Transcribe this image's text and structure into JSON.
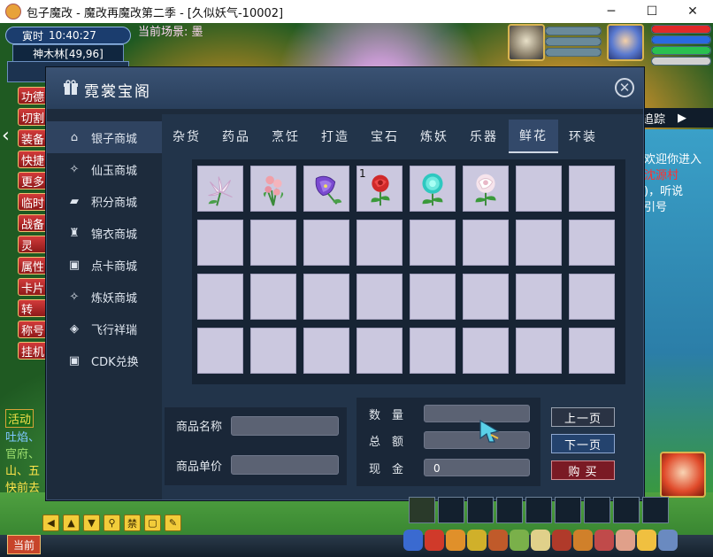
{
  "window": {
    "title": "包子魔改 - 魔改再魔改第二季 - [久似妖气-10002]",
    "min": "─",
    "max": "☐",
    "close": "✕"
  },
  "hud": {
    "clock_label": "寅时",
    "clock_time": "10:40:27",
    "location": "神木林[49,96]",
    "scene_label": "当前场景: 墨"
  },
  "sidebar_buttons": [
    "功德",
    "切割",
    "装备",
    "快捷",
    "更多",
    "临时",
    "战备",
    "灵",
    "属性",
    "卡片",
    "转",
    "称号",
    "挂机"
  ],
  "chat": {
    "tag": "活动",
    "lines": [
      "吐焰、",
      "官府、",
      "山、五",
      "快前去"
    ]
  },
  "right_panel": {
    "track": "追踪",
    "notice_1": "欢迎你进入",
    "notice_2": "沈源村",
    "notice_3": ")，听说",
    "notice_4": "引号"
  },
  "modal": {
    "title": "霓裳宝阁",
    "close": "✕",
    "nav": [
      {
        "label": "银子商城",
        "icon": "home-icon",
        "glyph": "⌂"
      },
      {
        "label": "仙玉商城",
        "icon": "gem-icon",
        "glyph": "✧"
      },
      {
        "label": "积分商城",
        "icon": "chat-icon",
        "glyph": "▰"
      },
      {
        "label": "锦衣商城",
        "icon": "shirt-icon",
        "glyph": "♜"
      },
      {
        "label": "点卡商城",
        "icon": "card-icon",
        "glyph": "▣"
      },
      {
        "label": "炼妖商城",
        "icon": "gem-icon",
        "glyph": "✧"
      },
      {
        "label": "飞行祥瑞",
        "icon": "layers-icon",
        "glyph": "◈"
      },
      {
        "label": "CDK兑换",
        "icon": "card-icon",
        "glyph": "▣"
      }
    ],
    "active_nav": 0,
    "tabs": [
      "杂货",
      "药品",
      "烹饪",
      "打造",
      "宝石",
      "炼妖",
      "乐器",
      "鲜花",
      "环装"
    ],
    "active_tab": 7,
    "items": [
      {
        "name": "white-lily",
        "qty": ""
      },
      {
        "name": "pink-flower-bunch",
        "qty": ""
      },
      {
        "name": "purple-bellflower",
        "qty": ""
      },
      {
        "name": "red-rose",
        "qty": "1"
      },
      {
        "name": "cyan-chrysanthemum",
        "qty": ""
      },
      {
        "name": "white-rose",
        "qty": ""
      }
    ],
    "info": {
      "name_label": "商品名称",
      "price_label": "商品单价"
    },
    "buy": {
      "qty_label": "数　量",
      "total_label": "总　额",
      "cash_label": "现　金",
      "cash_value": "0"
    },
    "buttons": {
      "prev": "上一页",
      "next": "下一页",
      "buy": "购 买"
    }
  },
  "bottom": {
    "current": "当前",
    "forbid": "禁"
  }
}
